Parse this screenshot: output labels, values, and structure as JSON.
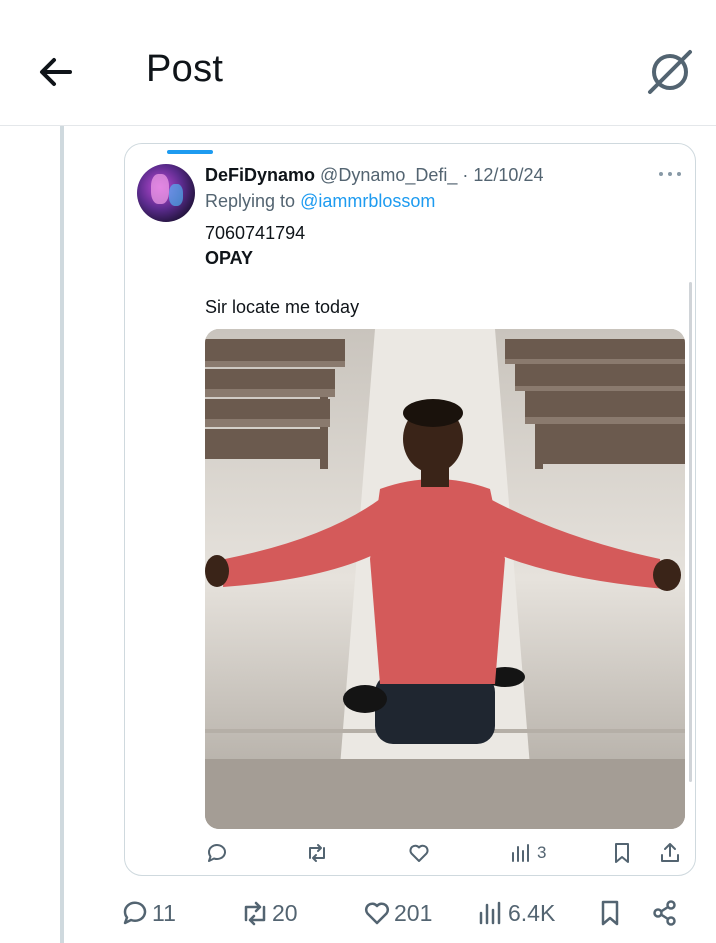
{
  "header": {
    "title": "Post",
    "back_icon": "arrow-left-icon",
    "grok_icon": "grok-icon"
  },
  "quote": {
    "author_name": "DeFiDynamo",
    "author_handle": "@Dynamo_Defi_",
    "separator_date": "· 12/10/24",
    "replying_prefix": "Replying to",
    "replying_handle": "@iammrblossom",
    "text_lines": [
      "7060741794",
      "OPAY",
      "Sir locate me today"
    ],
    "more_icon": "more-horizontal-icon",
    "media_description": "",
    "actions": {
      "views": "3"
    }
  },
  "post_actions": {
    "replies": "11",
    "reposts": "20",
    "likes": "201",
    "views": "6.4K"
  },
  "colors": {
    "accent": "#1d9bf0",
    "secondary_text": "#536471",
    "border": "#cfd9de"
  }
}
